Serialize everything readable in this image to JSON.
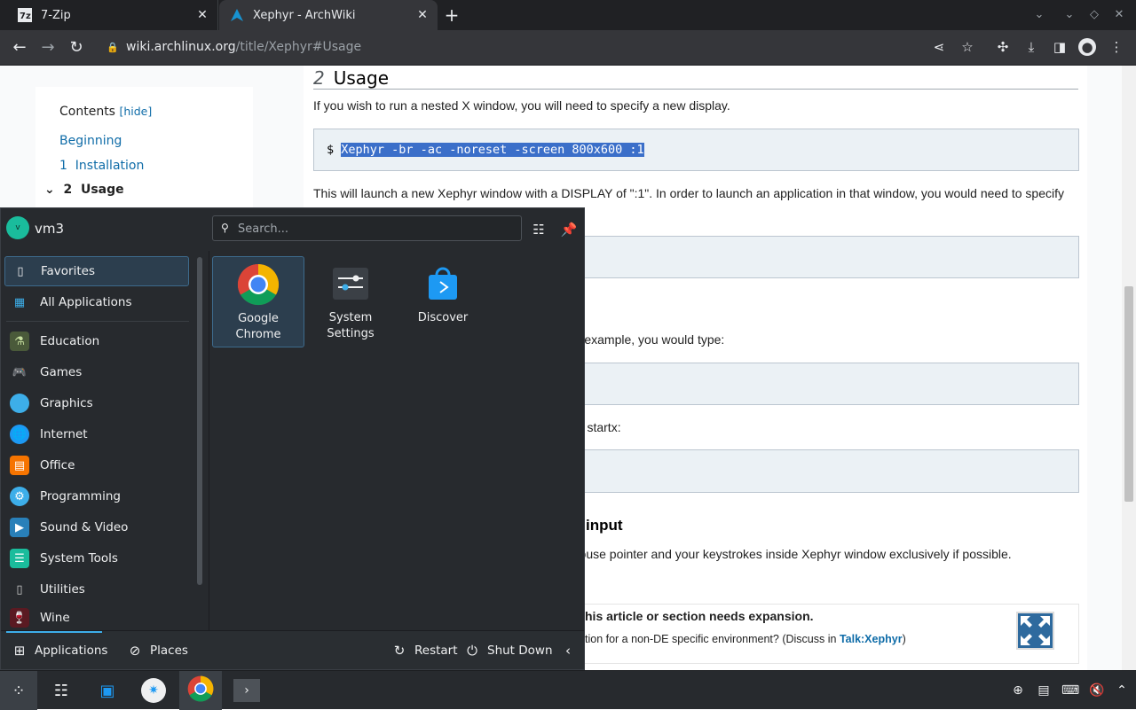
{
  "browser": {
    "tabs": [
      {
        "title": "7-Zip",
        "icon": "7zip-icon",
        "active": false
      },
      {
        "title": "Xephyr - ArchWiki",
        "icon": "archlinux-icon",
        "active": true
      }
    ],
    "url_host": "wiki.archlinux.org",
    "url_path": "/title/Xephyr#Usage"
  },
  "toc": {
    "heading": "Contents",
    "hide_link": "[hide]",
    "items": [
      "Beginning",
      "1  Installation",
      "2  Usage"
    ]
  },
  "article": {
    "section_number": "2",
    "section_title": "Usage",
    "para1": "If you wish to run a nested X window, you will need to specify a new display.",
    "code_prompt": "$",
    "code_command": "Xephyr -br -ac -noreset -screen 800x600 :1",
    "para2": "This will launch a new Xephyr window with a DISPLAY of \":1\". In order to launch an application in that window, you would need to specify",
    "para3_fragment": "or example, you would type:",
    "para4_fragment": "ng startx:",
    "h3_fragment": "input",
    "para5_fragment": " mouse pointer and your keystrokes inside Xephyr window exclusively if possible.",
    "notice_title": "his article or section needs expansion.",
    "notice_text_prefix": "tion for a non-DE specific environment? (Discuss in ",
    "notice_link": "Talk:Xephyr",
    "notice_text_suffix": ")"
  },
  "launcher": {
    "user": "vm3",
    "avatar_letter": "v",
    "search_placeholder": "Search...",
    "categories": [
      {
        "label": "Favorites",
        "icon": "bookmark-icon"
      },
      {
        "label": "All Applications",
        "icon": "grid-icon"
      },
      {
        "label": "Education",
        "icon": "education-icon"
      },
      {
        "label": "Games",
        "icon": "gamepad-icon"
      },
      {
        "label": "Graphics",
        "icon": "graphics-icon"
      },
      {
        "label": "Internet",
        "icon": "globe-icon"
      },
      {
        "label": "Office",
        "icon": "office-icon"
      },
      {
        "label": "Programming",
        "icon": "programming-icon"
      },
      {
        "label": "Sound & Video",
        "icon": "multimedia-icon"
      },
      {
        "label": "System Tools",
        "icon": "system-tools-icon"
      },
      {
        "label": "Utilities",
        "icon": "utilities-icon"
      },
      {
        "label": "Wine",
        "icon": "wine-icon"
      }
    ],
    "apps": [
      {
        "line1": "Google",
        "line2": "Chrome"
      },
      {
        "line1": "System",
        "line2": "Settings"
      },
      {
        "line1": "Discover",
        "line2": ""
      }
    ],
    "footer": {
      "applications": "Applications",
      "places": "Places",
      "restart": "Restart",
      "shutdown": "Shut Down"
    }
  },
  "colors": {
    "accent": "#3daee9",
    "selection": "#3b6fc9",
    "panel": "#272a2e",
    "chrome_dark": "#202124"
  }
}
